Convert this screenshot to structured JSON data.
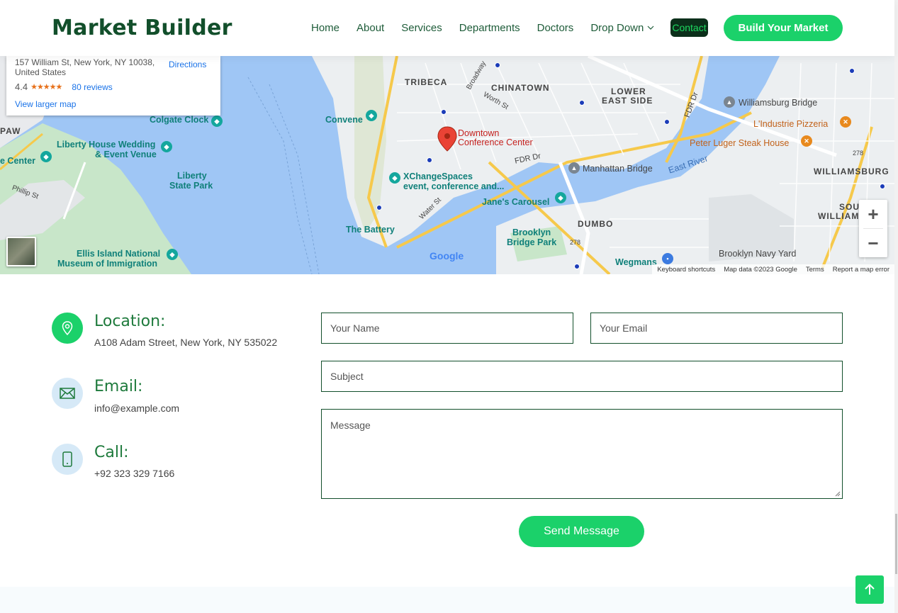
{
  "brand": {
    "name": "Market Builder"
  },
  "nav": {
    "items": [
      "Home",
      "About",
      "Services",
      "Departments",
      "Doctors",
      "Drop Down"
    ],
    "active": "Contact",
    "cta": "Build Your Market"
  },
  "map": {
    "card": {
      "address": "157 William St, New York, NY 10038, United States",
      "directions": "Directions",
      "rating": "4.4",
      "stars": "★★★★★",
      "reviews": "80 reviews",
      "larger_map": "View larger map"
    },
    "neighborhoods": [
      "TRIBECA",
      "CHINATOWN",
      "LOWER",
      "EAST SIDE",
      "WILLIAMSBURG",
      "SOU",
      "WILLIAM",
      "DUMBO",
      "PAW"
    ],
    "places": {
      "williamsburg_bridge": "Williamsburg Bridge",
      "lindustrie": "L'Industrie Pizzeria",
      "peter_luger": "Peter Luger Steak House",
      "manhattan_bridge": "Manhattan Bridge",
      "east_river": "East River",
      "fdr": "FDR Dr",
      "fdr2": "FDR Dr",
      "colgate": "Colgate Clock",
      "convene": "Convene",
      "liberty_wedding": "Liberty House Wedding",
      "liberty_wedding2": "& Event Venue",
      "liberty_park": "Liberty",
      "liberty_park2": "State Park",
      "center": "e Center",
      "phillip": "Phillip St",
      "downtown": "Downtown",
      "downtown2": "Conference Center",
      "xchange": "XChangeSpaces",
      "xchange2": "event, conference and...",
      "janes": "Jane's Carousel",
      "battery": "The Battery",
      "brooklyn_park": "Brooklyn",
      "brooklyn_park2": "Bridge Park",
      "ellis": "Ellis Island National",
      "ellis2": "Museum of Immigration",
      "navy_yard": "Brooklyn Navy Yard",
      "wegmans": "Wegmans",
      "broadway": "Broadway",
      "worth": "Worth St",
      "water": "Water St",
      "route278": "278",
      "route278b": "278"
    },
    "google": "Google",
    "attribution": [
      "Keyboard shortcuts",
      "Map data ©2023 Google",
      "Terms",
      "Report a map error"
    ]
  },
  "contact": {
    "location": {
      "title": "Location:",
      "text": "A108 Adam Street, New York, NY 535022"
    },
    "email": {
      "title": "Email:",
      "text": "info@example.com"
    },
    "call": {
      "title": "Call:",
      "text": "+92 323 329 7166"
    }
  },
  "form": {
    "name_placeholder": "Your Name",
    "email_placeholder": "Your Email",
    "subject_placeholder": "Subject",
    "message_placeholder": "Message",
    "submit": "Send Message"
  },
  "colors": {
    "accent": "#1bd16a",
    "brand": "#124f2b",
    "heading": "#1e7a3c"
  },
  "icons": [
    "map-pin-icon",
    "envelope-icon",
    "phone-icon",
    "arrow-up-icon",
    "chevron-down-icon",
    "zoom-in-icon",
    "zoom-out-icon"
  ]
}
